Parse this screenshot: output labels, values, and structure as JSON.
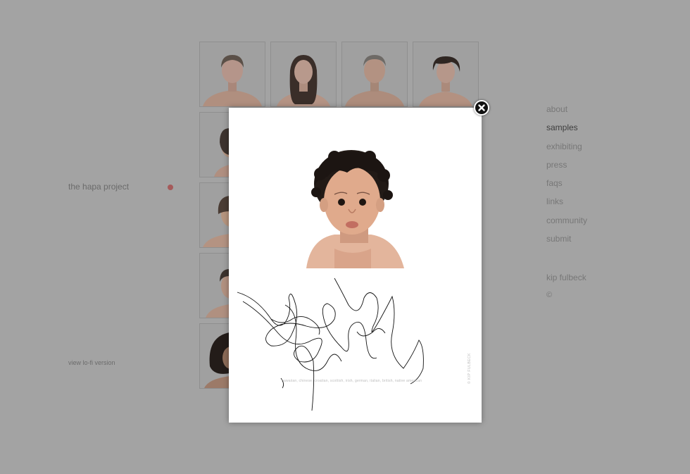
{
  "site": {
    "title": "the hapa project",
    "lofi_link": "view lo-fi version"
  },
  "nav": {
    "items": [
      {
        "label": "about"
      },
      {
        "label": "samples"
      },
      {
        "label": "exhibiting"
      },
      {
        "label": "press"
      },
      {
        "label": "faqs"
      },
      {
        "label": "links"
      },
      {
        "label": "community"
      },
      {
        "label": "submit"
      }
    ],
    "active": "samples",
    "author": "kip fulbeck",
    "copyright": "©"
  },
  "lightbox": {
    "caption": "hawaiian, chinese, croatian, scottish, irish, german, italian, british, native american",
    "credit": "© KIP FULBECK"
  },
  "colors": {
    "background": "#a3a3a3",
    "active_dot": "#a55a5a",
    "nav_text": "#777777",
    "nav_active": "#3d3d3d"
  },
  "icons": {
    "close": "close-icon"
  }
}
